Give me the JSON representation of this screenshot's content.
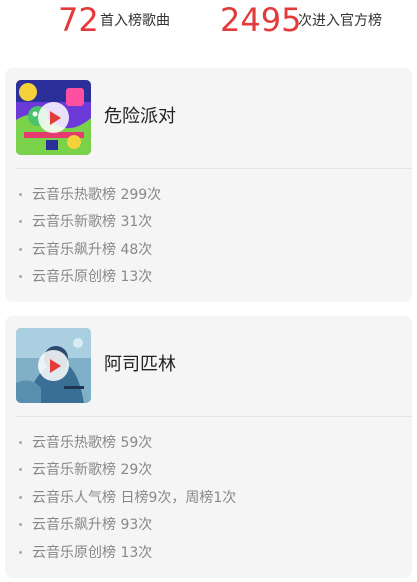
{
  "stats": [
    {
      "value": "72",
      "label": "首入榜歌曲"
    },
    {
      "value": "2495",
      "label": "次进入官方榜"
    }
  ],
  "songs": [
    {
      "title": "危险派对",
      "entries": [
        "云音乐热歌榜 299次",
        "云音乐新歌榜 31次",
        "云音乐飙升榜 48次",
        "云音乐原创榜 13次"
      ]
    },
    {
      "title": "阿司匹林",
      "entries": [
        "云音乐热歌榜 59次",
        "云音乐新歌榜 29次",
        "云音乐人气榜 日榜9次，周榜1次",
        "云音乐飙升榜 93次",
        "云音乐原创榜 13次"
      ]
    }
  ],
  "colors": {
    "accent": "#e33a3a",
    "card_bg": "#f5f5f5"
  },
  "icons": {
    "play": "play-icon"
  }
}
